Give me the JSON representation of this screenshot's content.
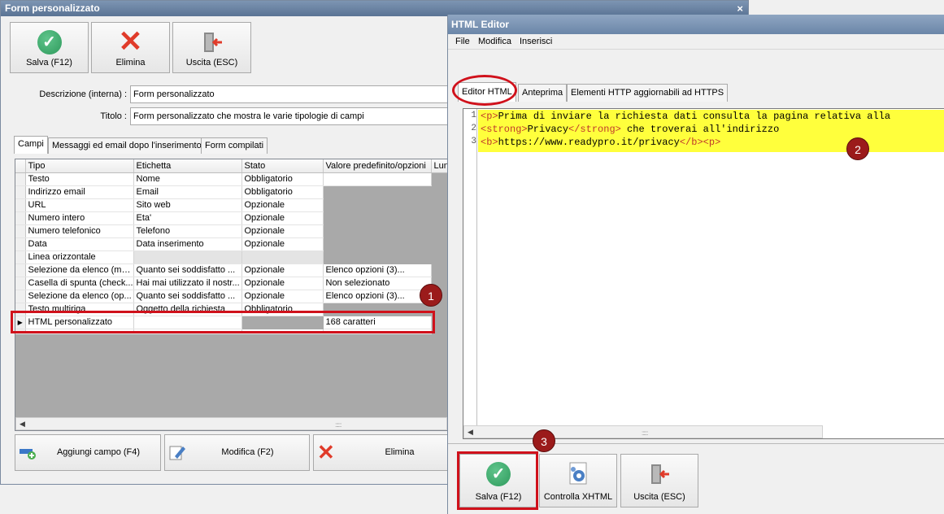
{
  "main_window": {
    "title": "Form personalizzato",
    "close_glyph": "×",
    "toolbar": [
      {
        "label": "Salva (F12)",
        "icon": "check-circle-icon"
      },
      {
        "label": "Elimina",
        "icon": "red-x-icon"
      },
      {
        "label": "Uscita (ESC)",
        "icon": "exit-door-icon"
      }
    ],
    "fields": {
      "descrizione_label": "Descrizione (interna) :",
      "descrizione_value": "Form personalizzato",
      "titolo_label": "Titolo :",
      "titolo_value": "Form personalizzato che mostra le varie tipologie di campi"
    },
    "tabs": [
      "Campi",
      "Messaggi ed email dopo l'inserimento",
      "Form compilati"
    ],
    "grid": {
      "columns": [
        "Tipo",
        "Etichetta",
        "Stato",
        "Valore predefinito/opzioni",
        "Lun"
      ],
      "rows": [
        [
          "Testo",
          "Nome",
          "Obbligatorio",
          ""
        ],
        [
          "Indirizzo email",
          "Email",
          "Obbligatorio",
          ""
        ],
        [
          "URL",
          "Sito web",
          "Opzionale",
          ""
        ],
        [
          "Numero intero",
          "Eta'",
          "Opzionale",
          ""
        ],
        [
          "Numero telefonico",
          "Telefono",
          "Opzionale",
          ""
        ],
        [
          "Data",
          "Data inserimento",
          "Opzionale",
          ""
        ],
        [
          "Linea orizzontale",
          "",
          "",
          ""
        ],
        [
          "Selezione da elenco (me...",
          "Quanto sei soddisfatto ...",
          "Opzionale",
          "Elenco opzioni (3)..."
        ],
        [
          "Casella di spunta (check...",
          "Hai mai utilizzato il nostr...",
          "Opzionale",
          "Non selezionato"
        ],
        [
          "Selezione da elenco (op...",
          "Quanto sei soddisfatto ...",
          "Opzionale",
          "Elenco opzioni (3)..."
        ],
        [
          "Testo multiriga",
          "Oggetto della richiesta",
          "Obbligatorio",
          ""
        ],
        [
          "HTML personalizzato",
          "",
          "",
          "168 caratteri"
        ]
      ],
      "selected_row_index": 11,
      "scroll_grip": "::::::"
    },
    "bottom_buttons": [
      {
        "label": "Aggiungi campo (F4)",
        "icon": "add-field-icon"
      },
      {
        "label": "Modifica (F2)",
        "icon": "edit-pencil-icon"
      },
      {
        "label": "Elimina",
        "icon": "red-x-icon"
      }
    ]
  },
  "editor_window": {
    "title": "HTML Editor",
    "menu": [
      "File",
      "Modifica",
      "Inserisci"
    ],
    "tabs": [
      "Editor HTML",
      "Anteprima",
      "Elementi HTTP aggiornabili ad HTTPS"
    ],
    "active_tab_index": 0,
    "code_lines": [
      {
        "num": "1",
        "segments": [
          {
            "t": "<p>",
            "tag": true
          },
          {
            "t": "Prima di inviare la richiesta dati consulta la pagina relativa alla",
            "tag": false
          }
        ]
      },
      {
        "num": "2",
        "segments": [
          {
            "t": "<strong>",
            "tag": true
          },
          {
            "t": "Privacy",
            "tag": false
          },
          {
            "t": "</strong>",
            "tag": true
          },
          {
            "t": " che troverai all'indirizzo",
            "tag": false
          }
        ]
      },
      {
        "num": "3",
        "segments": [
          {
            "t": "<b>",
            "tag": true
          },
          {
            "t": "https://www.readypro.it/privacy",
            "tag": false
          },
          {
            "t": "</b><p>",
            "tag": true
          }
        ]
      }
    ],
    "highlight_color": "#ffff3c",
    "buttons": [
      {
        "label": "Salva (F12)",
        "icon": "check-circle-icon"
      },
      {
        "label": "Controlla XHTML",
        "icon": "xhtml-check-icon"
      },
      {
        "label": "Uscita (ESC)",
        "icon": "exit-door-icon"
      }
    ],
    "scroll_grip": "::::::"
  },
  "annotations": {
    "badges": [
      "1",
      "2",
      "3"
    ],
    "badge_color": "#9b1b1b",
    "box_color": "#d0111b"
  }
}
